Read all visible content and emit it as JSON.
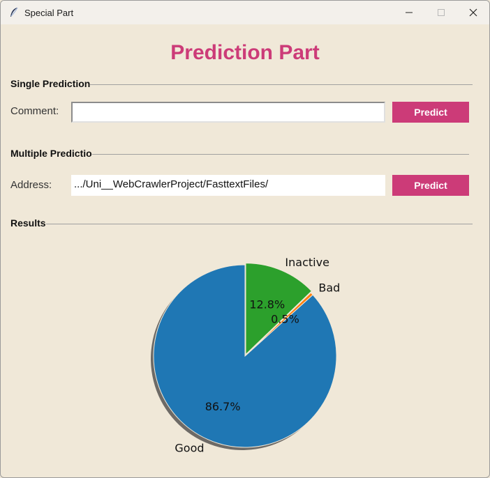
{
  "window": {
    "title": "Special Part",
    "controls": {
      "minimize": "minimize",
      "maximize": "maximize",
      "close": "close"
    }
  },
  "heading": "Prediction Part",
  "single": {
    "group_label": "Single Prediction",
    "field_label": "Comment:",
    "value": "",
    "button_label": "Predict"
  },
  "multiple": {
    "group_label": "Multiple Predictio",
    "field_label": "Address:",
    "value": ".../Uni__WebCrawlerProject/FasttextFiles/",
    "button_label": "Predict"
  },
  "results": {
    "group_label": "Results"
  },
  "colors": {
    "accent": "#cc3b78",
    "good": "#1f77b4",
    "bad": "#ff7f0e",
    "inactive": "#2ca02c",
    "background": "#f0e8d8"
  },
  "chart_data": {
    "type": "pie",
    "title": "",
    "shadow": true,
    "slices": [
      {
        "label": "Good",
        "value": 86.7,
        "pct_text": "86.7%",
        "color": "#1f77b4",
        "explode": false
      },
      {
        "label": "Bad",
        "value": 0.5,
        "pct_text": "0.5%",
        "color": "#ff7f0e",
        "explode": false
      },
      {
        "label": "Inactive",
        "value": 12.8,
        "pct_text": "12.8%",
        "color": "#2ca02c",
        "explode": true
      }
    ]
  }
}
